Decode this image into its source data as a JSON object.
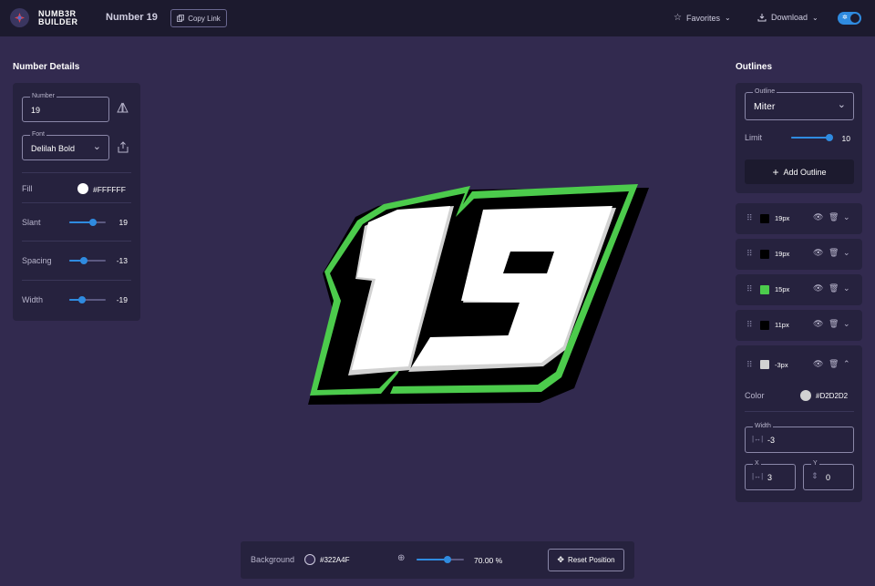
{
  "app": {
    "logo_line1": "NUMB3R",
    "logo_line2": "BUILDER",
    "page_title": "Number 19",
    "copy_link": "Copy Link",
    "favorites": "Favorites",
    "download": "Download",
    "dark_mode": true
  },
  "details": {
    "title": "Number Details",
    "number_legend": "Number",
    "number_value": "19",
    "font_legend": "Font",
    "font_value": "Delilah Bold",
    "fill_label": "Fill",
    "fill_value": "#FFFFFF",
    "slant_label": "Slant",
    "slant_value": "19",
    "slant_fraction": 0.65,
    "spacing_label": "Spacing",
    "spacing_value": "-13",
    "spacing_fraction": 0.4,
    "width_label": "Width",
    "width_value": "-19",
    "width_fraction": 0.35
  },
  "outlines": {
    "title": "Outlines",
    "outline_legend": "Outline",
    "outline_value": "Miter",
    "limit_label": "Limit",
    "limit_value": "10",
    "limit_fraction": 1.0,
    "add_button": "Add Outline",
    "layers": [
      {
        "size": "19px",
        "color": "#000000",
        "expanded": false
      },
      {
        "size": "19px",
        "color": "#000000",
        "expanded": false
      },
      {
        "size": "15px",
        "color": "#4CCB4C",
        "expanded": false
      },
      {
        "size": "11px",
        "color": "#000000",
        "expanded": false
      },
      {
        "size": "-3px",
        "color": "#D2D2D2",
        "expanded": true
      }
    ],
    "expanded": {
      "color_label": "Color",
      "color_value": "#D2D2D2",
      "width_legend": "Width",
      "width_value": "-3",
      "x_legend": "X",
      "x_value": "3",
      "y_legend": "Y",
      "y_value": "0"
    }
  },
  "canvas": {
    "number_text": "19",
    "fill_color": "#FFFFFF",
    "outline_colors": [
      "#000000",
      "#000000",
      "#4CCB4C",
      "#000000",
      "#D2D2D2"
    ]
  },
  "bottom": {
    "background_label": "Background",
    "background_value": "#322A4F",
    "zoom_value": "70.00 %",
    "zoom_fraction": 0.65,
    "reset_button": "Reset Position"
  }
}
